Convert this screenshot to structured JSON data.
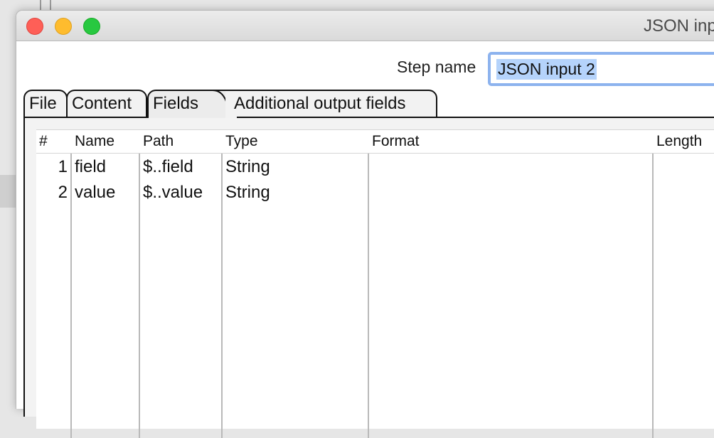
{
  "window": {
    "title": "JSON inp"
  },
  "step": {
    "label": "Step name",
    "value": "JSON input 2"
  },
  "tabs": [
    {
      "label": "File"
    },
    {
      "label": "Content"
    },
    {
      "label": "Fields"
    },
    {
      "label": "Additional output fields"
    }
  ],
  "active_tab": "Fields",
  "table": {
    "columns": [
      "#",
      "Name",
      "Path",
      "Type",
      "Format",
      "Length"
    ],
    "rows": [
      {
        "num": "1",
        "name": "field",
        "path": "$..field",
        "type": "String",
        "format": "",
        "length": ""
      },
      {
        "num": "2",
        "name": "value",
        "path": "$..value",
        "type": "String",
        "format": "",
        "length": ""
      }
    ]
  },
  "colors": {
    "close": "#fe5f57",
    "minimize": "#febc2e",
    "maximize": "#28c840",
    "focus_ring": "#8db3ee",
    "selection": "#b5d3fb"
  }
}
